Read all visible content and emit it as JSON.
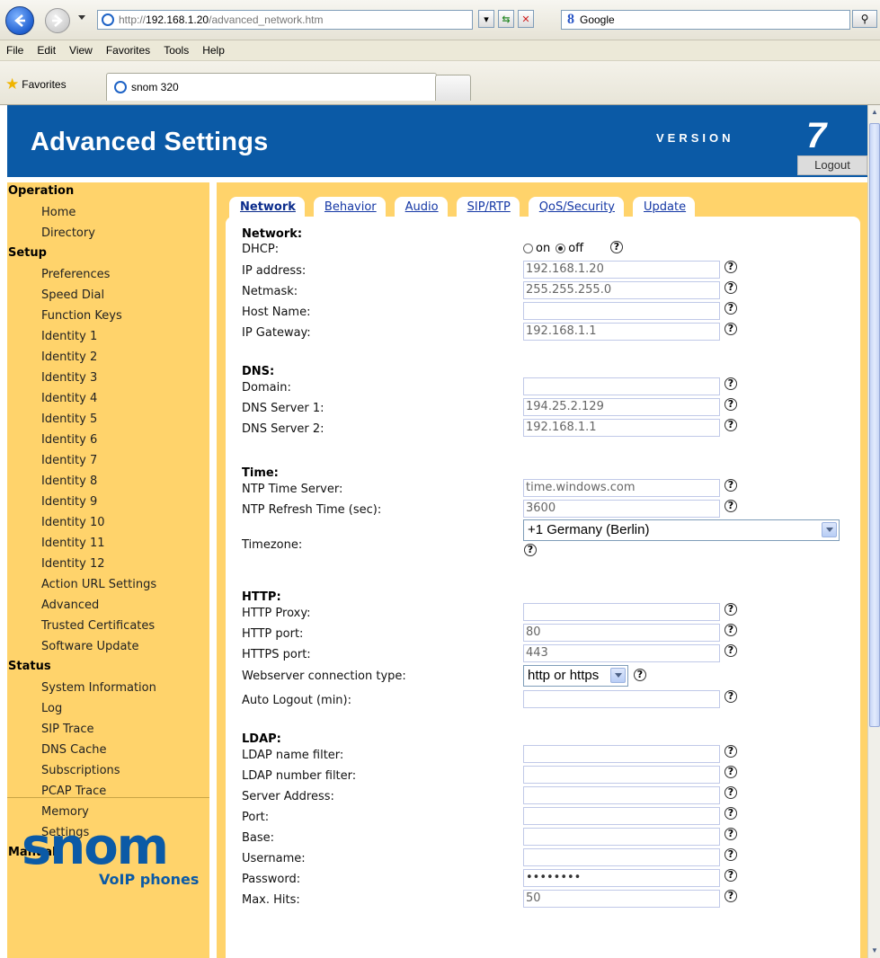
{
  "browser": {
    "url_prefix": "http://",
    "url_host": "192.168.1.20",
    "url_path": "/advanced_network.htm",
    "search_text": "Google",
    "menu": [
      "File",
      "Edit",
      "View",
      "Favorites",
      "Tools",
      "Help"
    ],
    "favorites_label": "Favorites",
    "tab_title": "snom 320"
  },
  "header": {
    "title": "Advanced Settings",
    "version_label": "VERSION",
    "version_number": "7",
    "logout_label": "Logout"
  },
  "sidebar": {
    "sections": [
      {
        "title": "Operation",
        "items": [
          "Home",
          "Directory"
        ]
      },
      {
        "title": "Setup",
        "items": [
          "Preferences",
          "Speed Dial",
          "Function Keys",
          "Identity 1",
          "Identity 2",
          "Identity 3",
          "Identity 4",
          "Identity 5",
          "Identity 6",
          "Identity 7",
          "Identity 8",
          "Identity 9",
          "Identity 10",
          "Identity 11",
          "Identity 12",
          "Action URL Settings",
          "Advanced",
          "Trusted Certificates",
          "Software Update"
        ]
      },
      {
        "title": "Status",
        "items": [
          "System Information",
          "Log",
          "SIP Trace",
          "DNS Cache",
          "Subscriptions",
          "PCAP Trace",
          "Memory",
          "Settings"
        ]
      },
      {
        "title": "Manual",
        "items": []
      }
    ],
    "logo_text": "snom",
    "logo_sub": "VoIP phones"
  },
  "tabs": [
    {
      "label": "Network",
      "active": true
    },
    {
      "label": "Behavior",
      "active": false
    },
    {
      "label": "Audio",
      "active": false
    },
    {
      "label": "SIP/RTP",
      "active": false
    },
    {
      "label": "QoS/Security",
      "active": false
    },
    {
      "label": "Update",
      "active": false
    }
  ],
  "form": {
    "network": {
      "heading": "Network:",
      "dhcp_label": "DHCP:",
      "dhcp_on": "on",
      "dhcp_off": "off",
      "dhcp_value": "off",
      "ip_label": "IP address:",
      "ip_value": "192.168.1.20",
      "netmask_label": "Netmask:",
      "netmask_value": "255.255.255.0",
      "hostname_label": "Host Name:",
      "hostname_value": "",
      "gateway_label": "IP Gateway:",
      "gateway_value": "192.168.1.1"
    },
    "dns": {
      "heading": "DNS:",
      "domain_label": "Domain:",
      "domain_value": "",
      "server1_label": "DNS Server 1:",
      "server1_value": "194.25.2.129",
      "server2_label": "DNS Server 2:",
      "server2_value": "192.168.1.1"
    },
    "time": {
      "heading": "Time:",
      "ntp_label": "NTP Time Server:",
      "ntp_value": "time.windows.com",
      "refresh_label": "NTP Refresh Time (sec):",
      "refresh_value": "3600",
      "tz_label": "Timezone:",
      "tz_value": "+1 Germany (Berlin)"
    },
    "http": {
      "heading": "HTTP:",
      "proxy_label": "HTTP Proxy:",
      "proxy_value": "",
      "port_label": "HTTP port:",
      "port_value": "80",
      "https_label": "HTTPS port:",
      "https_value": "443",
      "conn_label": "Webserver connection type:",
      "conn_value": "http or https",
      "logout_label": "Auto Logout (min):",
      "logout_value": ""
    },
    "ldap": {
      "heading": "LDAP:",
      "name_filter_label": "LDAP name filter:",
      "name_filter_value": "",
      "number_filter_label": "LDAP number filter:",
      "number_filter_value": "",
      "server_label": "Server Address:",
      "server_value": "",
      "port_label": "Port:",
      "port_value": "",
      "base_label": "Base:",
      "base_value": "",
      "user_label": "Username:",
      "user_value": "",
      "pass_label": "Password:",
      "pass_value": "••••••••",
      "hits_label": "Max. Hits:",
      "hits_value": "50"
    },
    "help_glyph": "?"
  }
}
